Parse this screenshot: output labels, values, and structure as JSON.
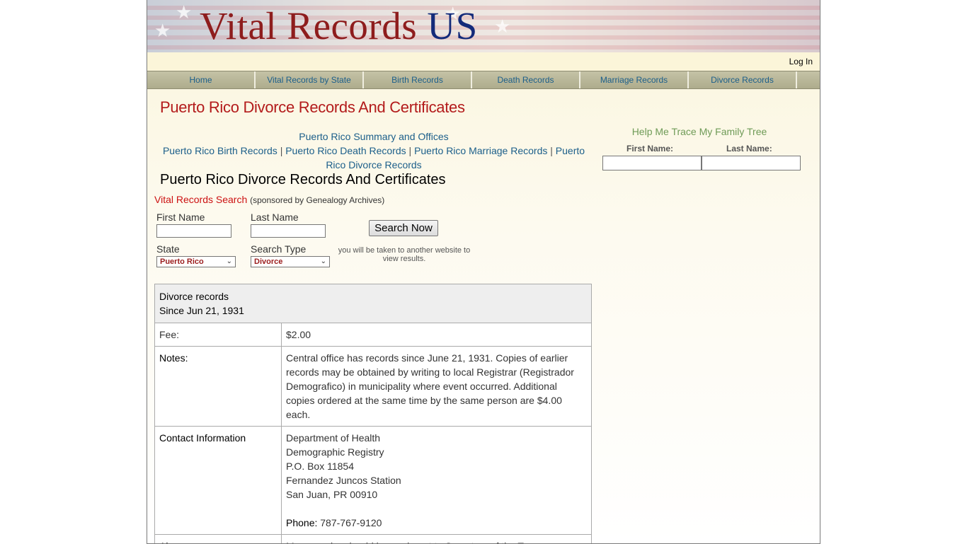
{
  "site": {
    "logo_part1": "Vital Records",
    "logo_part2": "US",
    "login": "Log In"
  },
  "nav": [
    {
      "label": "Home"
    },
    {
      "label": "Vital Records by State"
    },
    {
      "label": "Birth Records"
    },
    {
      "label": "Death Records"
    },
    {
      "label": "Marriage Records"
    },
    {
      "label": "Divorce Records"
    }
  ],
  "page": {
    "title": "Puerto Rico Divorce Records And Certificates",
    "subtitle": "Puerto Rico Divorce Records And Certificates",
    "links": {
      "summary": "Puerto Rico Summary and Offices",
      "birth": "Puerto Rico Birth Records",
      "death": "Puerto Rico Death Records",
      "marriage": "Puerto Rico Marriage Records",
      "divorce": "Puerto Rico Divorce Records",
      "separator": "|"
    }
  },
  "search": {
    "title": "Vital Records Search",
    "sponsor": "(sponsored by Genealogy Archives)",
    "first_name_label": "First Name",
    "last_name_label": "Last Name",
    "state_label": "State",
    "state_value": "Puerto Rico",
    "type_label": "Search Type",
    "type_value": "Divorce",
    "button": "Search Now",
    "note": "you will be taken to another website to view results."
  },
  "records": {
    "header_line1": "Divorce records",
    "header_line2": "Since Jun 21, 1931",
    "fee_label": "Fee:",
    "fee_value": "$2.00",
    "notes_label": "Notes:",
    "notes_value": "Central office has records since June 21, 1931. Copies of earlier records may be obtained by writing to local Registrar (Registrador Demografico) in municipality where event occurred. Additional copies ordered at the same time by the same person are $4.00 each.",
    "contact_label": "Contact Information",
    "contact_lines": [
      "Department of Health",
      "Demographic Registry",
      "P.O. Box 11854",
      "Fernandez Juncos Station",
      "San Juan, PR 00910"
    ],
    "phone_label": "Phone:",
    "phone_value": "787-767-9120",
    "also_label": "Also",
    "also_value": "Money order should be made out to Secretary of the Treasury"
  },
  "family_tree": {
    "title": "Help Me Trace My Family Tree",
    "first_name_label": "First Name:",
    "last_name_label": "Last Name:"
  }
}
